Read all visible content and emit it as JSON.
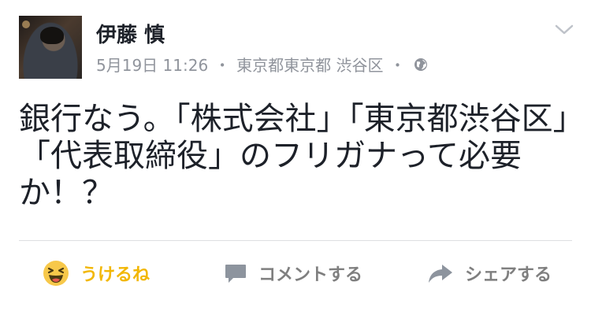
{
  "post": {
    "author": "伊藤 慎",
    "date": "5月19日 11:26",
    "separator": "・",
    "location": "東京都東京都 渋谷区",
    "body": "銀行なう。「株式会社」「東京都渋谷区」「代表取締役」のフリガナって必要か！？"
  },
  "actions": {
    "reaction_label": "うけるね",
    "comment_label": "コメントする",
    "share_label": "シェアする"
  },
  "colors": {
    "reaction": "#f2b705",
    "muted": "#90949c",
    "text": "#1d2129",
    "action_gray": "#7f7f7f"
  },
  "icons": {
    "reaction": "laughing-face-icon",
    "comment": "speech-bubble-icon",
    "share": "share-arrow-icon",
    "privacy": "globe-icon",
    "menu": "chevron-down-icon"
  }
}
